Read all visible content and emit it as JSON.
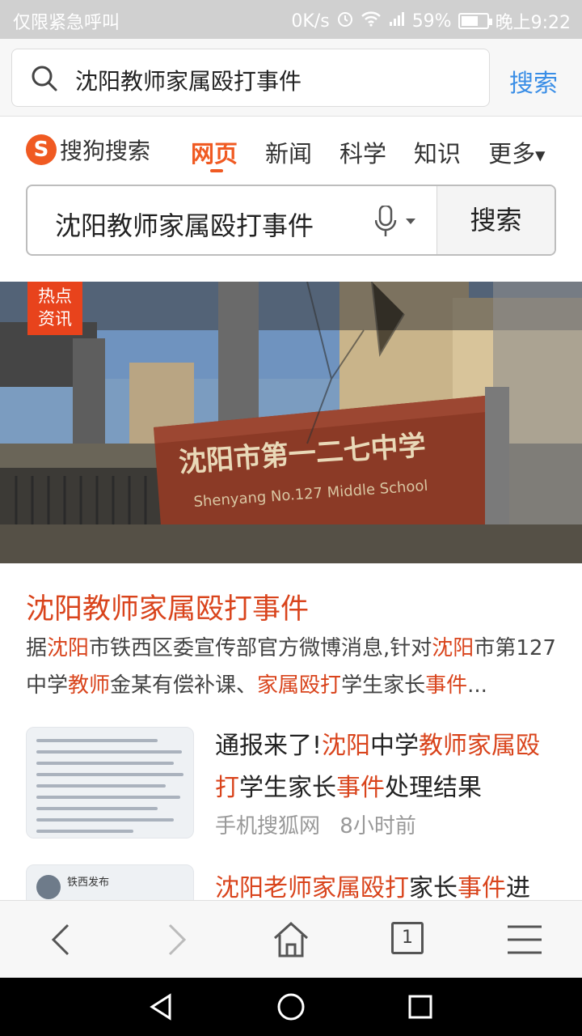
{
  "status_bar": {
    "carrier": "仅限紧急呼叫",
    "speed": "0K/s",
    "battery_percent": "59%",
    "time": "晚上9:22"
  },
  "browser": {
    "url_query": "沈阳教师家属殴打事件",
    "search_label": "搜索"
  },
  "sogou": {
    "logo_text": "搜狗搜索",
    "tabs": [
      {
        "label": "网页",
        "active": true
      },
      {
        "label": "新闻"
      },
      {
        "label": "科学"
      },
      {
        "label": "知识"
      },
      {
        "label": "更多"
      }
    ],
    "search_query": "沈阳教师家属殴打事件",
    "search_button": "搜索"
  },
  "hero": {
    "badge_line1": "热点",
    "badge_line2": "资讯"
  },
  "result1": {
    "title": "沈阳教师家属殴打事件",
    "snippet_parts": [
      {
        "t": "据",
        "h": false
      },
      {
        "t": "沈阳",
        "h": true
      },
      {
        "t": "市铁西区委宣传部官方微博消息,针对",
        "h": false
      },
      {
        "t": "沈阳",
        "h": true
      },
      {
        "t": "市第127中学",
        "h": false
      },
      {
        "t": "教师",
        "h": true
      },
      {
        "t": "金某有偿补课、",
        "h": false
      },
      {
        "t": "家属殴打",
        "h": true
      },
      {
        "t": "学生家长",
        "h": false
      },
      {
        "t": "事件",
        "h": true
      },
      {
        "t": "...",
        "h": false
      }
    ]
  },
  "result2": {
    "title_parts": [
      {
        "t": "通报来了!",
        "h": false
      },
      {
        "t": "沈阳",
        "h": true
      },
      {
        "t": "中学",
        "h": false
      },
      {
        "t": "教师家属殴打",
        "h": true
      },
      {
        "t": "学生家长",
        "h": false
      },
      {
        "t": "事件",
        "h": true
      },
      {
        "t": "处理结果",
        "h": false
      }
    ],
    "source": "手机搜狐网",
    "time": "8小时前"
  },
  "result3": {
    "thumb_name": "铁西发布",
    "title_parts": [
      {
        "t": "沈阳老师家属殴打",
        "h": true
      },
      {
        "t": "家长",
        "h": false
      },
      {
        "t": "事件",
        "h": true
      },
      {
        "t": "进",
        "h": false
      }
    ]
  },
  "toolbar": {
    "tab_count": "1"
  },
  "colors": {
    "accent": "#d9441c",
    "sogou_orange": "#f05a22",
    "link_blue": "#3a8ee6"
  }
}
